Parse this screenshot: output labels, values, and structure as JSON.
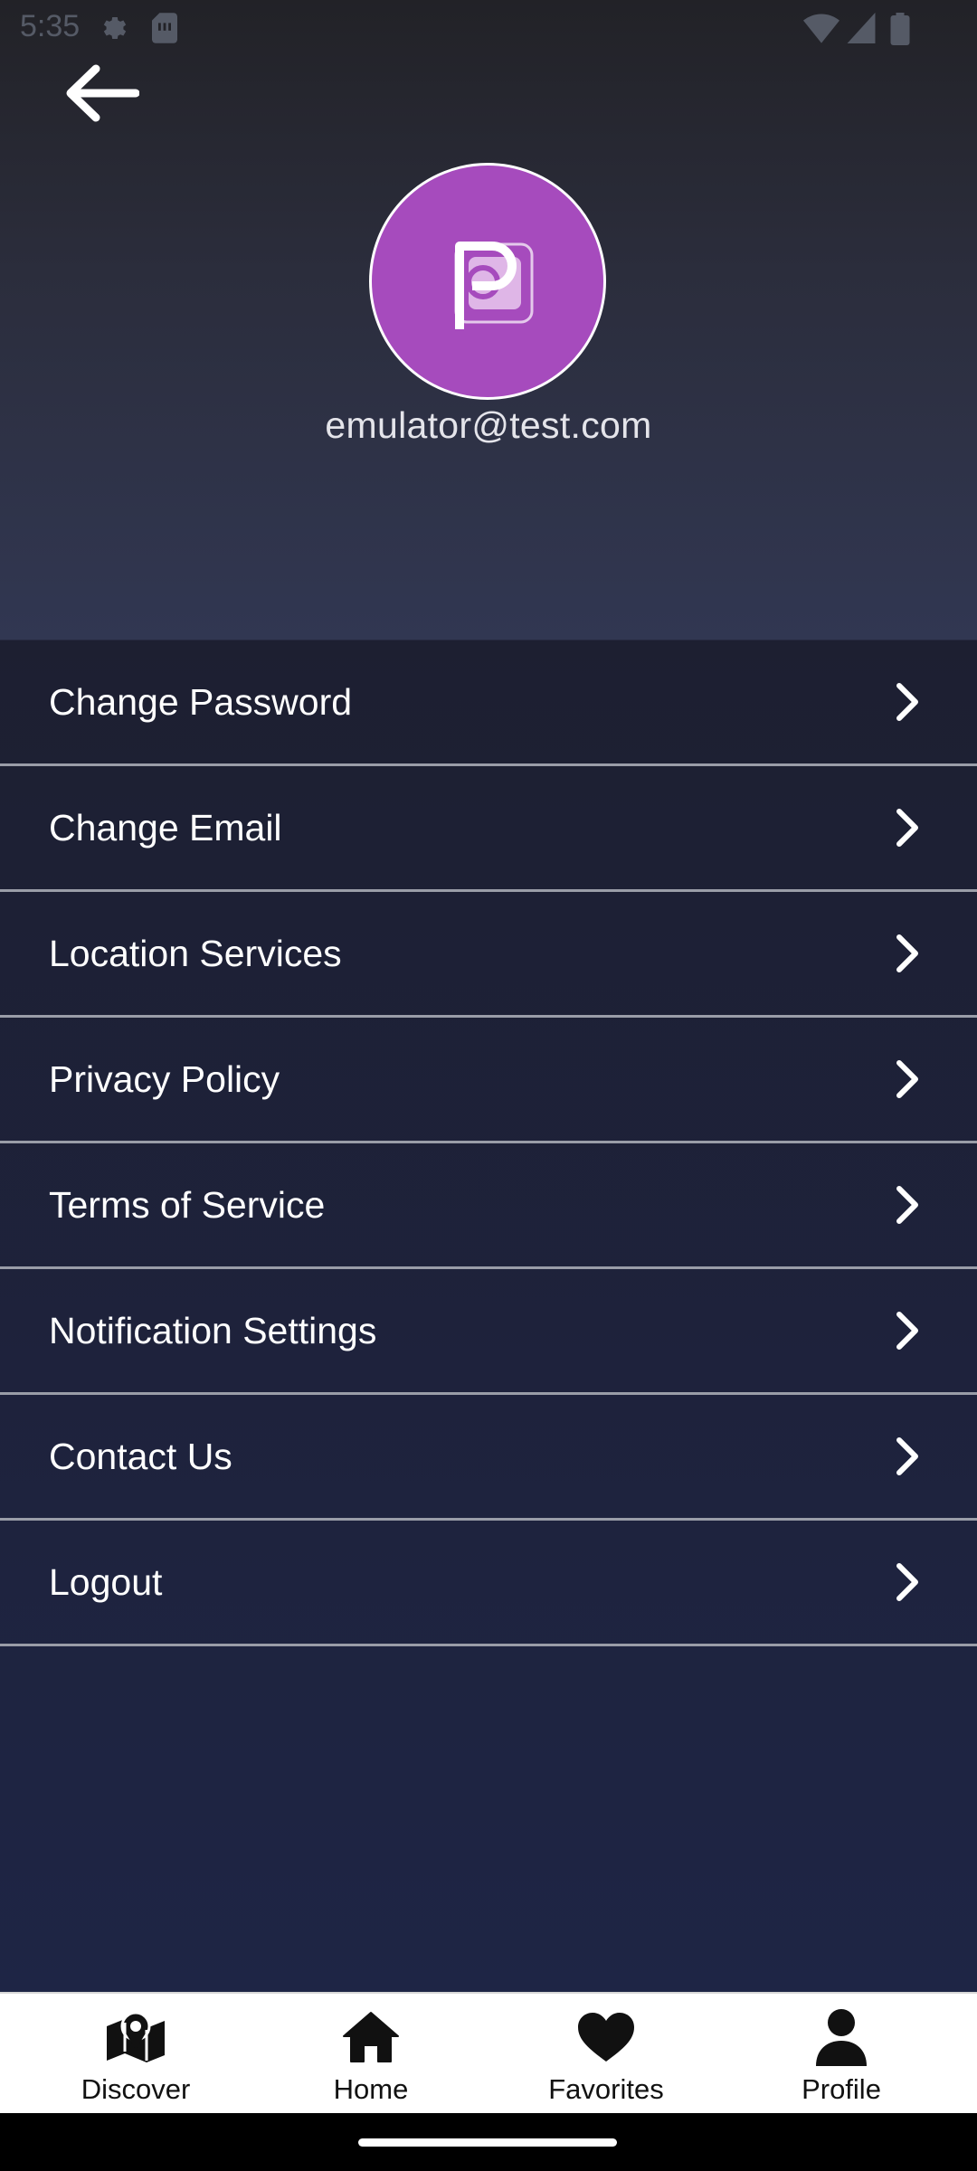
{
  "status_bar": {
    "time": "5:35",
    "icons": [
      "gear-icon",
      "sim-card-icon",
      "wifi-icon",
      "cellular-signal-icon",
      "battery-icon"
    ]
  },
  "header": {
    "back_icon": "arrow-left-icon",
    "avatar_logo": "P",
    "email": "emulator@test.com"
  },
  "menu": {
    "items": [
      {
        "label": "Change Password"
      },
      {
        "label": "Change Email"
      },
      {
        "label": "Location Services"
      },
      {
        "label": "Privacy Policy"
      },
      {
        "label": "Terms of Service"
      },
      {
        "label": "Notification Settings"
      },
      {
        "label": "Contact Us"
      },
      {
        "label": "Logout"
      }
    ],
    "chevron_icon": "chevron-right-icon"
  },
  "bottom_nav": {
    "items": [
      {
        "label": "Discover",
        "icon": "map-pin-icon"
      },
      {
        "label": "Home",
        "icon": "home-icon"
      },
      {
        "label": "Favorites",
        "icon": "heart-icon"
      },
      {
        "label": "Profile",
        "icon": "person-icon"
      }
    ],
    "selected": "Profile"
  },
  "colors": {
    "avatar_bg": "#a64bbd",
    "menu_bg": "#1d1f31",
    "page_bg": "#1e2545",
    "divider": "#9a9da8"
  }
}
